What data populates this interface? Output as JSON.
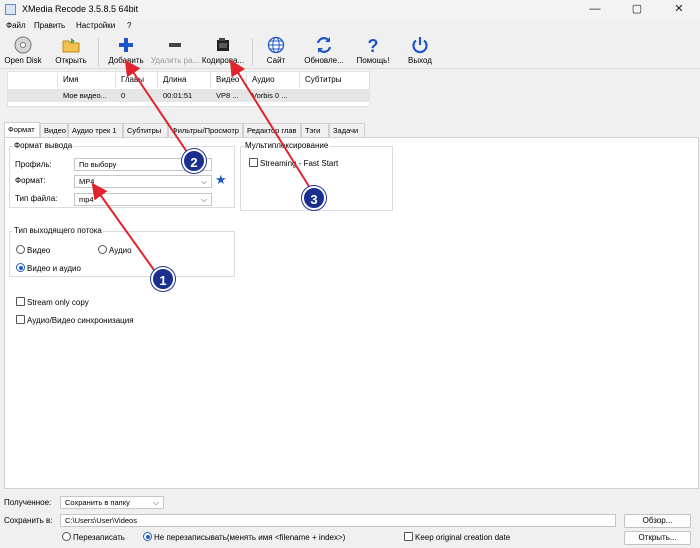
{
  "window": {
    "title": "XMedia Recode 3.5.8.5 64bit",
    "minimize": "—",
    "maximize": "▢",
    "close": "✕"
  },
  "menu": [
    "Файл",
    "Править",
    "Настройки",
    "?"
  ],
  "toolbar": {
    "open_disk": "Open Disk",
    "open": "Открыть",
    "add": "Добавить",
    "remove": "Удалить ра...",
    "encode": "Кодирова...",
    "site": "Сайт",
    "update": "Обновле...",
    "help": "Помощь!",
    "exit": "Выход"
  },
  "table": {
    "columns": [
      "Имя",
      "Главы",
      "Длина",
      "Видео",
      "Аудио",
      "Субтитры"
    ],
    "rows": [
      [
        "Мое видео...",
        "0",
        "00:01:51",
        "VP8 ...",
        "Vorbis 0 ...",
        ""
      ]
    ]
  },
  "tabs": [
    "Формат",
    "Видео",
    "Аудио трек 1",
    "Субтитры",
    "Фильтры/Просмотр",
    "Редактор глав",
    "Тэги",
    "Задачи"
  ],
  "format_output": {
    "group_label": "Формат вывода",
    "profile_label": "Профиль:",
    "profile_value": "По выбору",
    "format_label": "Формат:",
    "format_value": "MP4",
    "filetype_label": "Тип файла:",
    "filetype_value": "mp4"
  },
  "muxing": {
    "group_label": "Мультиплексирование",
    "streaming_label": "Streaming - Fast Start"
  },
  "stream_type": {
    "group_label": "Тип выходящего потока",
    "video": "Видео",
    "audio": "Аудио",
    "video_audio": "Видео и аудио"
  },
  "options": {
    "stream_copy": "Stream only copy",
    "av_sync": "Аудио/Видео синхронизация"
  },
  "bottom": {
    "received_label": "Полученное:",
    "received_value": "Сохранить в папку",
    "save_label": "Сохранить в:",
    "save_path": "C:\\Users\\User\\Videos",
    "browse": "Обзор...",
    "overwrite": "Перезаписать",
    "no_overwrite": "Не перезаписывать(менять имя <filename + index>)",
    "keep_date": "Keep original creation date",
    "open": "Открыть..."
  },
  "callouts": [
    "1",
    "2",
    "3"
  ],
  "colors": {
    "accent": "#1b2f8f",
    "arrow": "#e0232c",
    "add_icon": "#1e56c8",
    "help_icon": "#1e56c8"
  }
}
